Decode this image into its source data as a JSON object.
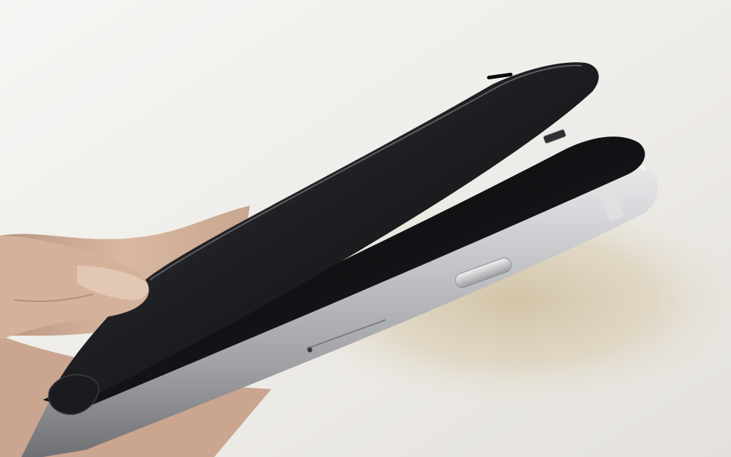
{
  "photo": {
    "subject": "smartphone-display-lifting-from-aluminum-frame",
    "colors": {
      "background": "#efedea",
      "shadow": "#d9cdb4",
      "frame_silver": "#b9babd",
      "frame_highlight": "#e6e7e9",
      "screen_black": "#121315",
      "screen_glass": "#2a2b2e",
      "skin": "#d9b8a2"
    },
    "icons": [
      "phone-screen",
      "phone-frame",
      "volume-button",
      "sim-tray",
      "speaker-slot",
      "hand"
    ]
  }
}
